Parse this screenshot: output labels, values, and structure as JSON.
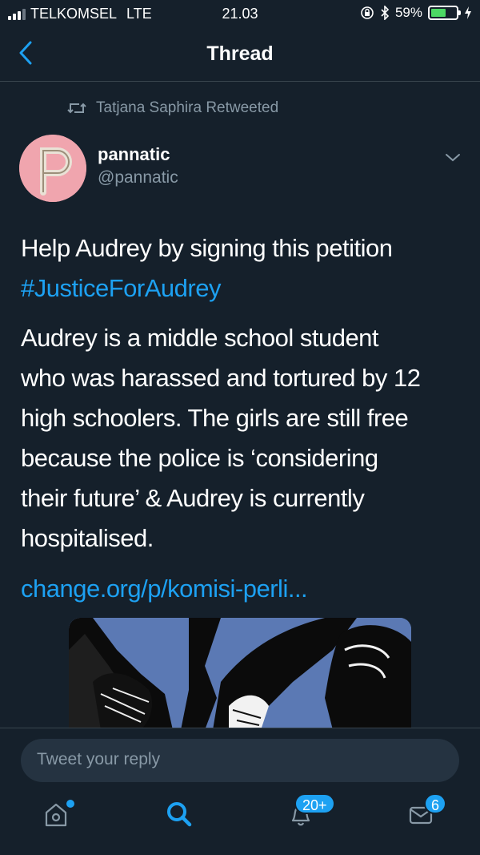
{
  "status_bar": {
    "carrier": "TELKOMSEL",
    "network": "LTE",
    "time": "21.03",
    "battery": "59%"
  },
  "header": {
    "title": "Thread",
    "back_icon": "chevron-left-icon"
  },
  "retweet": {
    "text": "Tatjana Saphira Retweeted",
    "icon": "retweet-icon"
  },
  "tweet": {
    "author_name": "pannatic",
    "author_handle": "@pannatic",
    "lines": [
      "Help Audrey by signing this petition",
      "#JusticeForAudrey",
      "Audrey is a middle school student",
      "who was harassed and tortured by 12",
      "high schoolers. The girls are still free",
      "because the police is ‘considering",
      "their future’ & Audrey is currently",
      "hospitalised.",
      "change.org/p/komisi-perli..."
    ]
  },
  "reply": {
    "placeholder": "Tweet your reply"
  },
  "tabbar": {
    "home_icon": "home-icon",
    "search_icon": "search-icon",
    "notifications_icon": "bell-icon",
    "notifications_badge": "20+",
    "messages_icon": "mail-icon",
    "messages_badge": "6"
  },
  "colors": {
    "background": "#15202b",
    "accent": "#1da1f2",
    "secondary_text": "#8899a6",
    "divider": "#38444d"
  }
}
